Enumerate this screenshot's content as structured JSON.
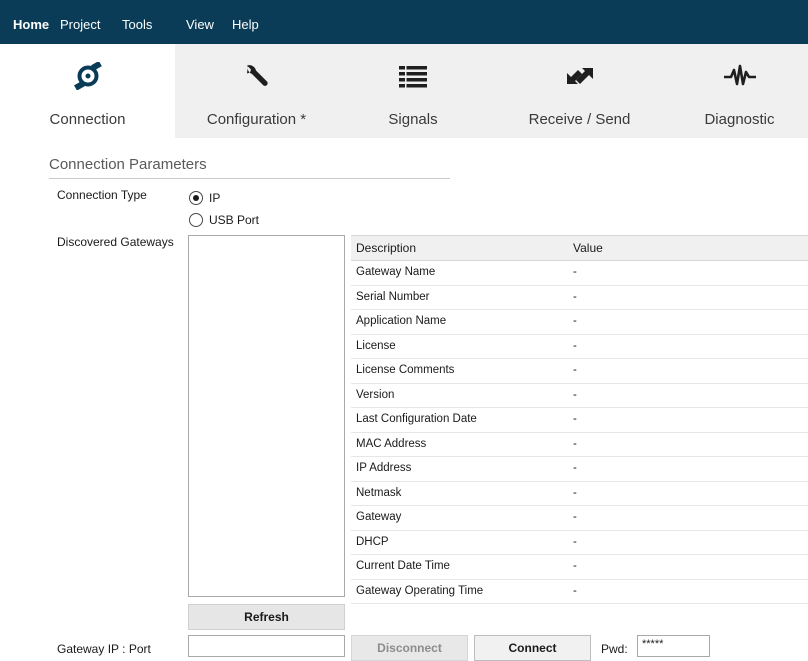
{
  "menu": {
    "home": "Home",
    "project": "Project",
    "tools": "Tools",
    "view": "View",
    "help": "Help"
  },
  "ribbon": {
    "tabs": [
      {
        "label": "Connection",
        "icon": "connection-icon",
        "active": true
      },
      {
        "label": "Configuration *",
        "icon": "wrench-icon",
        "active": false
      },
      {
        "label": "Signals",
        "icon": "list-icon",
        "active": false
      },
      {
        "label": "Receive / Send",
        "icon": "transfer-arrows-icon",
        "active": false
      },
      {
        "label": "Diagnostic",
        "icon": "pulse-icon",
        "active": false
      }
    ],
    "accent": "#0b3c57"
  },
  "connection": {
    "section_title": "Connection Parameters",
    "type_label": "Connection Type",
    "option_ip": "IP",
    "option_usb": "USB Port",
    "selected": "IP",
    "discovered_label": "Discovered Gateways",
    "refresh_label": "Refresh",
    "gateway_ip_label": "Gateway IP : Port",
    "gateway_ip_value": "",
    "disconnect_label": "Disconnect",
    "connect_label": "Connect",
    "pwd_label": "Pwd:",
    "pwd_value": "*****"
  },
  "info_table": {
    "headers": [
      "Description",
      "Value"
    ],
    "rows": [
      [
        "Gateway Name",
        "-"
      ],
      [
        "Serial Number",
        "-"
      ],
      [
        "Application Name",
        "-"
      ],
      [
        "License",
        "-"
      ],
      [
        "License Comments",
        "-"
      ],
      [
        "Version",
        "-"
      ],
      [
        "Last Configuration Date",
        "-"
      ],
      [
        "MAC Address",
        "-"
      ],
      [
        "IP Address",
        "-"
      ],
      [
        "Netmask",
        "-"
      ],
      [
        "Gateway",
        "-"
      ],
      [
        "DHCP",
        "-"
      ],
      [
        "Current Date Time",
        "-"
      ],
      [
        "Gateway Operating Time",
        "-"
      ]
    ]
  }
}
